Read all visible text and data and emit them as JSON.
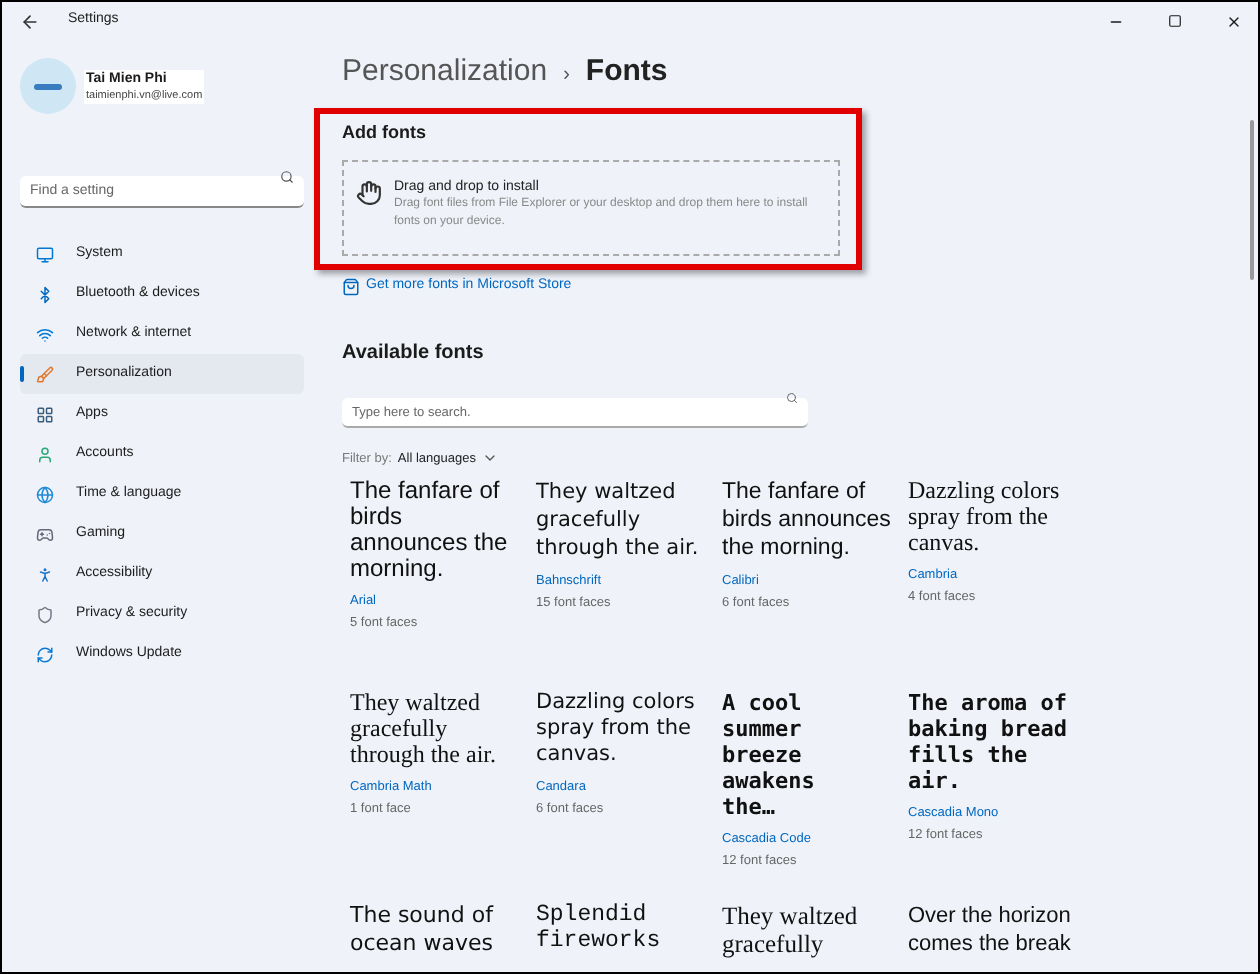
{
  "window": {
    "title": "Settings"
  },
  "account": {
    "name": "Tai Mien Phi",
    "email": "taimienphi.vn@live.com"
  },
  "search": {
    "placeholder": "Find a setting"
  },
  "sidebar": {
    "items": [
      {
        "label": "System",
        "selected": false
      },
      {
        "label": "Bluetooth & devices",
        "selected": false
      },
      {
        "label": "Network & internet",
        "selected": false
      },
      {
        "label": "Personalization",
        "selected": true
      },
      {
        "label": "Apps",
        "selected": false
      },
      {
        "label": "Accounts",
        "selected": false
      },
      {
        "label": "Time & language",
        "selected": false
      },
      {
        "label": "Gaming",
        "selected": false
      },
      {
        "label": "Accessibility",
        "selected": false
      },
      {
        "label": "Privacy & security",
        "selected": false
      },
      {
        "label": "Windows Update",
        "selected": false
      }
    ]
  },
  "breadcrumb": {
    "parent": "Personalization",
    "separator": "›",
    "current": "Fonts"
  },
  "add_fonts": {
    "heading": "Add fonts",
    "title": "Drag and drop to install",
    "description": "Drag font files from File Explorer or your desktop and drop them here to install fonts on your device."
  },
  "store_link": "Get more fonts in Microsoft Store",
  "available": {
    "heading": "Available fonts",
    "placeholder": "Type here to search.",
    "filter_label": "Filter by:",
    "filter_value": "All languages"
  },
  "fonts": [
    {
      "preview": "The fanfare of birds announces the morning.",
      "name": "Arial",
      "faces": "5 font faces"
    },
    {
      "preview": "They waltzed gracefully through the air.",
      "name": "Bahnschrift",
      "faces": "15 font faces"
    },
    {
      "preview": "The fanfare of birds announces the morning.",
      "name": "Calibri",
      "faces": "6 font faces"
    },
    {
      "preview": "Dazzling colors spray from the canvas.",
      "name": "Cambria",
      "faces": "4 font faces"
    },
    {
      "preview": "They waltzed gracefully through the air.",
      "name": "Cambria Math",
      "faces": "1 font face"
    },
    {
      "preview": "Dazzling colors spray from the canvas.",
      "name": "Candara",
      "faces": "6 font faces"
    },
    {
      "preview": "A cool summer breeze awakens the…",
      "name": "Cascadia Code",
      "faces": "12 font faces"
    },
    {
      "preview": "The aroma of baking bread fills the air.",
      "name": "Cascadia Mono",
      "faces": "12 font faces"
    },
    {
      "preview": "The sound of ocean waves"
    },
    {
      "preview": "Splendid fireworks"
    },
    {
      "preview": "They waltzed gracefully"
    },
    {
      "preview": "Over the horizon comes the break"
    }
  ]
}
